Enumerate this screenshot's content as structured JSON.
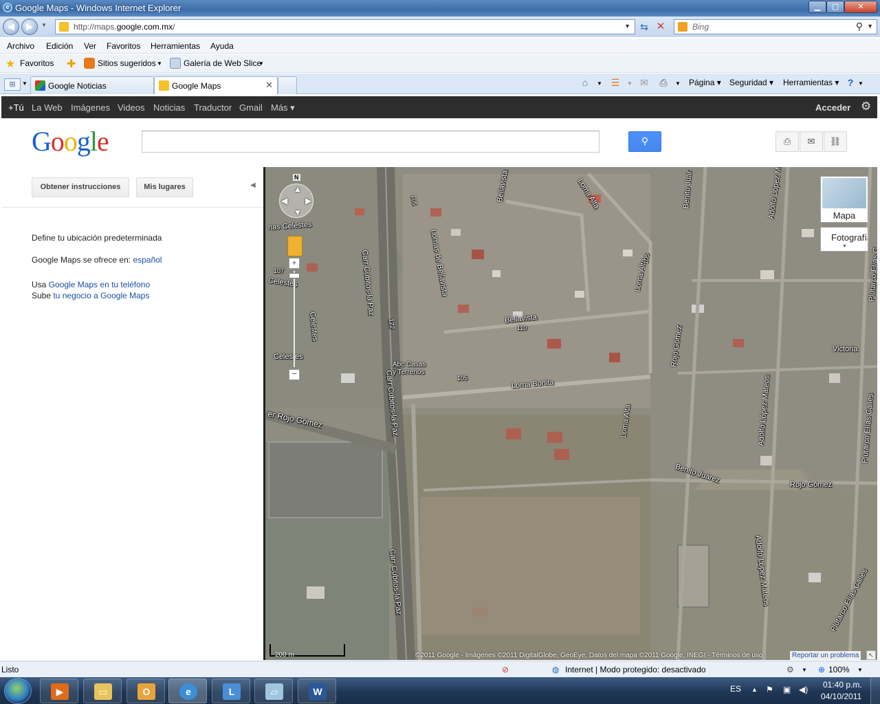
{
  "window": {
    "title": "Google Maps - Windows Internet Explorer"
  },
  "address": {
    "url_prefix": "http://maps.",
    "url_domain": "google.com.mx",
    "url_suffix": "/",
    "search_placeholder": "Bing"
  },
  "menu": [
    "Archivo",
    "Edición",
    "Ver",
    "Favoritos",
    "Herramientas",
    "Ayuda"
  ],
  "favorites_bar": {
    "favorites": "Favoritos",
    "suggested": "Sitios sugeridos",
    "gallery": "Galería de Web Slice"
  },
  "tabs": [
    {
      "label": "Google Noticias"
    },
    {
      "label": "Google Maps"
    }
  ],
  "command_bar": {
    "page": "Página",
    "security": "Seguridad",
    "tools": "Herramientas"
  },
  "gbar": {
    "items": [
      "+Tú",
      "La Web",
      "Imágenes",
      "Videos",
      "Noticias",
      "Traductor",
      "Gmail",
      "Más"
    ],
    "signin": "Acceder"
  },
  "google_logo": "Google",
  "panel": {
    "directions_button": "Obtener instrucciones",
    "my_places_button": "Mis lugares",
    "default_location_link": "Define tu ubicación predeterminada",
    "offered_in_text": "Google Maps se ofrece en:",
    "offered_in_link": "español",
    "use_text": "Usa",
    "use_link": "Google Maps en tu teléfono",
    "business_text": "Sube",
    "business_link": "tu negocio a Google Maps"
  },
  "map": {
    "north": "N",
    "type_map": "Mapa",
    "type_photo": "Fotografía",
    "labels": {
      "carr1": "Carr Cubitos-la Paz",
      "carr2": "Carr Cubitos-la Paz",
      "carr3": "Carr Cubitos-la Paz",
      "bellavista1": "Bellavista",
      "bellavista2": "Bellavista",
      "lomas_bellavista": "Lomas de Bellavista",
      "loma_alta1": "Loma Alta",
      "loma_alta2": "Loma Alta",
      "loma_alta3": "Loma Alta",
      "loma_bonita": "Loma Bonita",
      "celestes1": "nas Celestes",
      "celestes2": "Celestes",
      "celestes3": "Celestes",
      "celestes4": "Celestes",
      "rojo_gomez1": "er Rojo Gómez",
      "rojo_gomez2": "Rojo Gómez",
      "rojo_gomez3": "Rojo Gómez",
      "benito_juarez1": "Benito Juár",
      "benito_juarez2": "Benito Juárez",
      "adolfo1": "Adolfo López M",
      "adolfo2": "Adolfo López Mateos",
      "adolfo3": "Adolfo López Mateos",
      "plutarco1": "Plutarco Elías C",
      "plutarco2": "Plutarco Elías Calles",
      "plutarco3": "Plutarco Elías Calles",
      "victoria": "Victoria",
      "abc": "Abc Casas y Terrenos",
      "n105a": "105",
      "n105b": "105",
      "n105c": "105",
      "n107": "107",
      "n110": "110",
      "n122": "122"
    },
    "scale_label": "200 m",
    "copyright": "©2011 Google - Imágenes ©2011 DigitalGlobe, GeoEye, Datos del mapa ©2011 Google, INEGI - Términos de uso",
    "report": "Reportar un problema"
  },
  "statusbar": {
    "left": "Listo",
    "zone": "Internet | Modo protegido: desactivado",
    "zoom": "100%"
  },
  "taskbar": {
    "lang": "ES",
    "time": "01:40 p.m.",
    "date": "04/10/2011"
  }
}
